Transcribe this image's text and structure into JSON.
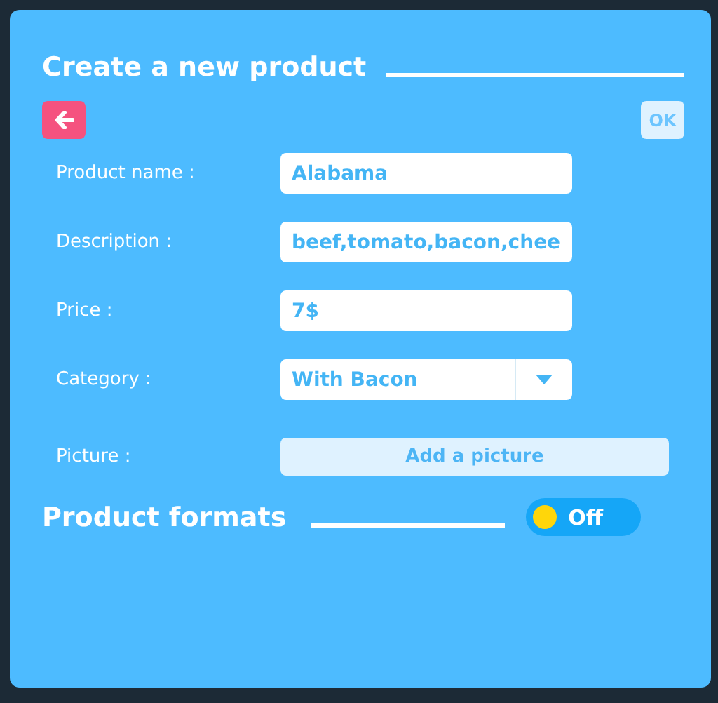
{
  "dialog": {
    "title": "Create a new product",
    "ok_button": "OK"
  },
  "fields": [
    {
      "kind": "text",
      "label": "Product name :",
      "value": "Alabama"
    },
    {
      "kind": "text",
      "label": "Description :",
      "value": "beef,tomato,bacon,chee"
    },
    {
      "kind": "text",
      "label": "Price :",
      "value": "7$"
    },
    {
      "kind": "select",
      "label": "Category :",
      "value": "With Bacon"
    },
    {
      "kind": "button",
      "label": "Picture :",
      "value": "Add a picture"
    }
  ],
  "formats": {
    "title": "Product formats",
    "toggle_label": "Off",
    "on": false
  }
}
